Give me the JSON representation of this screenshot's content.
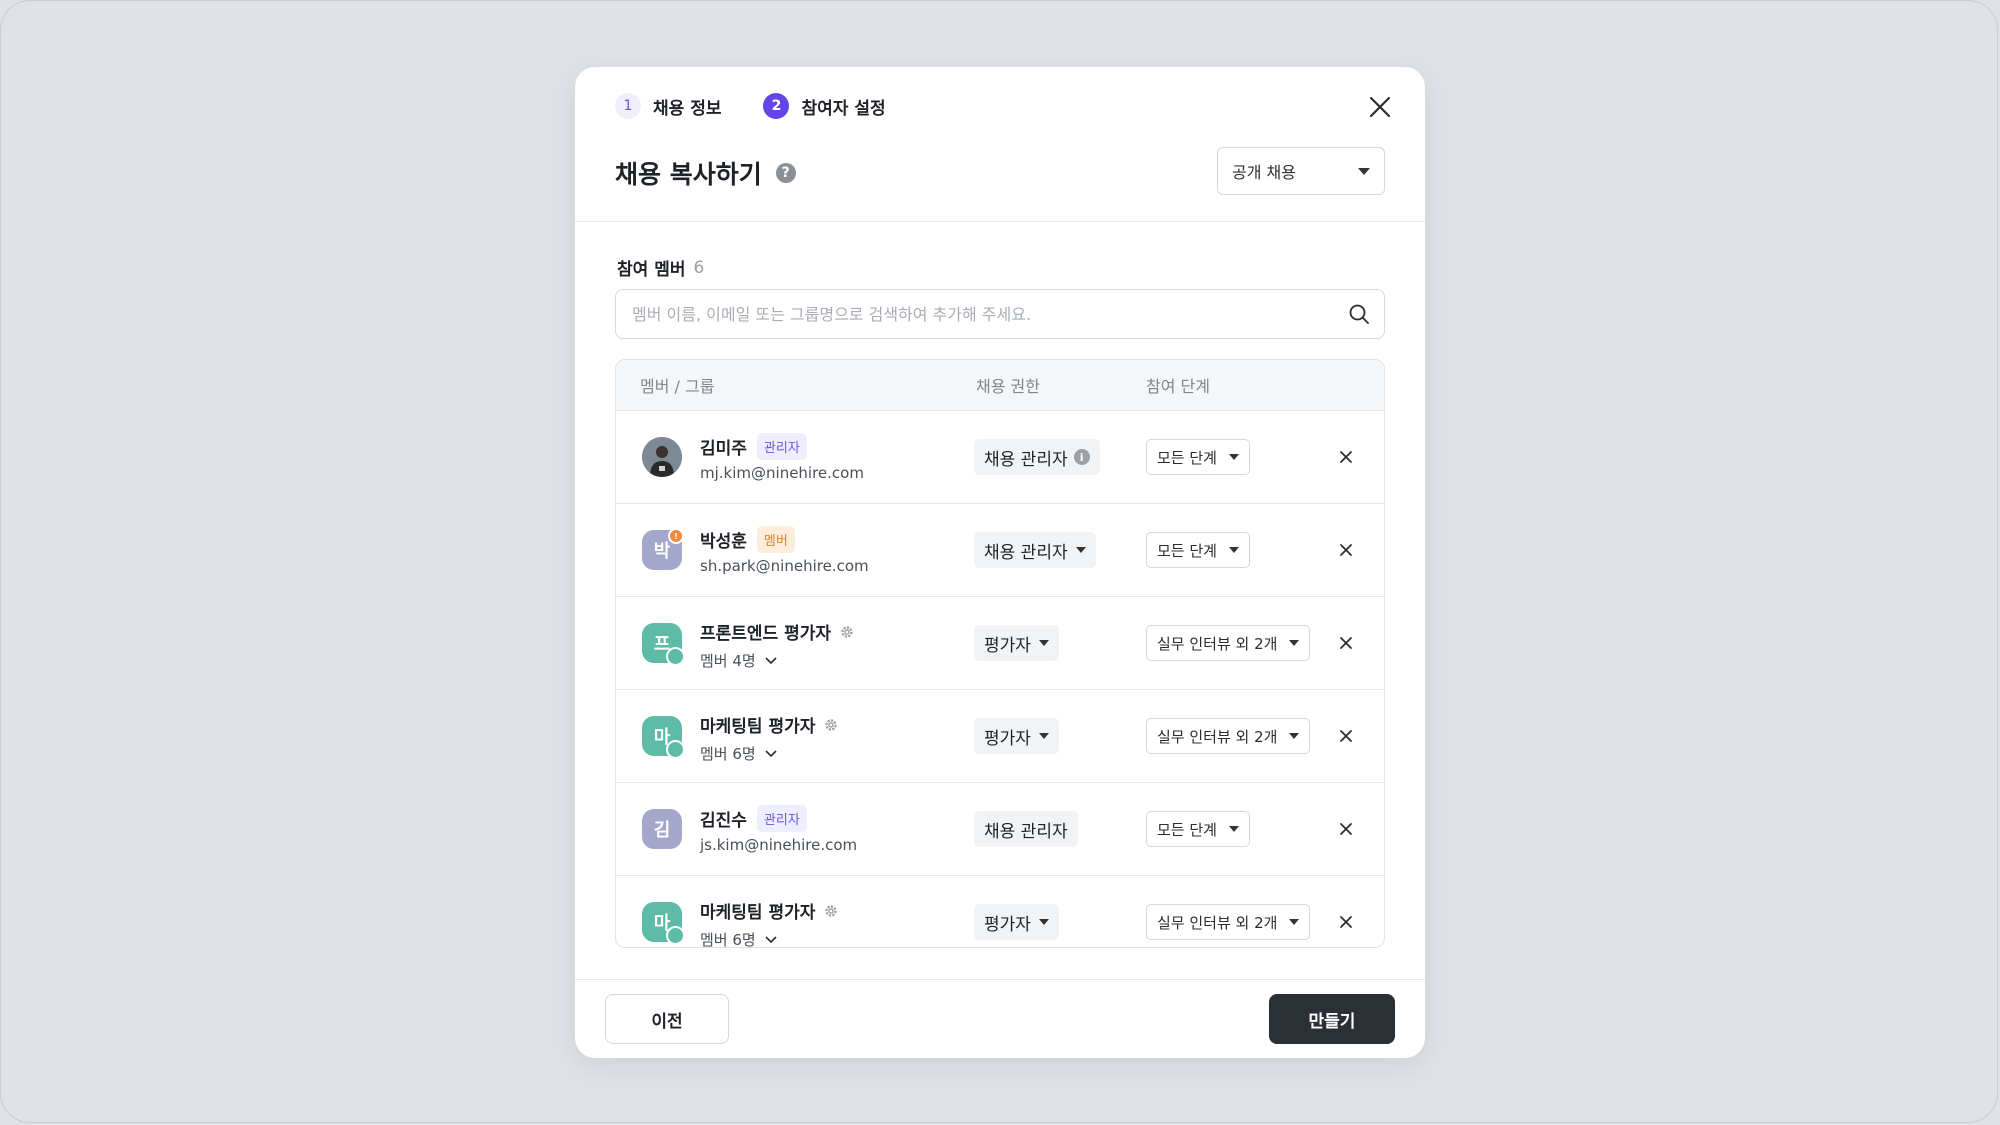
{
  "steps": [
    {
      "num": "1",
      "label": "채용 정보"
    },
    {
      "num": "2",
      "label": "참여자 설정"
    }
  ],
  "title": "채용 복사하기",
  "help_icon_text": "?",
  "type_select": {
    "value": "공개 채용"
  },
  "members_section": {
    "label": "참여 멤버",
    "count": "6"
  },
  "search": {
    "placeholder": "멤버 이름, 이메일 또는 그룹명으로 검색하여 추가해 주세요."
  },
  "table": {
    "headers": {
      "member": "멤버 / 그룹",
      "role": "채용 권한",
      "stage": "참여 단계"
    },
    "rows": [
      {
        "avatar_type": "photo",
        "avatar_text": "",
        "name": "김미주",
        "badge": "관리자",
        "badge_type": "admin",
        "sub": "mj.kim@ninehire.com",
        "role": "채용 관리자",
        "role_has_info": true,
        "role_dropdown": false,
        "stage": "모든 단계"
      },
      {
        "avatar_type": "purple",
        "avatar_text": "박",
        "avatar_dot": "!",
        "name": "박성훈",
        "badge": "멤버",
        "badge_type": "member",
        "sub": "sh.park@ninehire.com",
        "role": "채용 관리자",
        "role_dropdown": true,
        "stage": "모든 단계"
      },
      {
        "avatar_type": "teal",
        "avatar_text": "프",
        "group": true,
        "name": "프론트엔드 평가자",
        "sub": "멤버 4명",
        "role": "평가자",
        "role_dropdown": true,
        "stage": "실무 인터뷰 외 2개"
      },
      {
        "avatar_type": "teal",
        "avatar_text": "마",
        "group": true,
        "name": "마케팅팀 평가자",
        "sub": "멤버 6명",
        "role": "평가자",
        "role_dropdown": true,
        "stage": "실무 인터뷰 외 2개"
      },
      {
        "avatar_type": "purple",
        "avatar_text": "김",
        "name": "김진수",
        "badge": "관리자",
        "badge_type": "admin",
        "sub": "js.kim@ninehire.com",
        "role": "채용 관리자",
        "role_dropdown": false,
        "stage": "모든 단계"
      },
      {
        "avatar_type": "teal",
        "avatar_text": "마",
        "group": true,
        "name": "마케팅팀 평가자",
        "sub": "멤버 6명",
        "role": "평가자",
        "role_dropdown": true,
        "stage": "실무 인터뷰 외 2개"
      }
    ]
  },
  "footer": {
    "prev_label": "이전",
    "create_label": "만들기"
  },
  "colors": {
    "accent": "#6446e8",
    "primary_button": "#2b2f36",
    "avatar_teal": "#5dbba7",
    "avatar_purple": "#a4a7c9"
  }
}
